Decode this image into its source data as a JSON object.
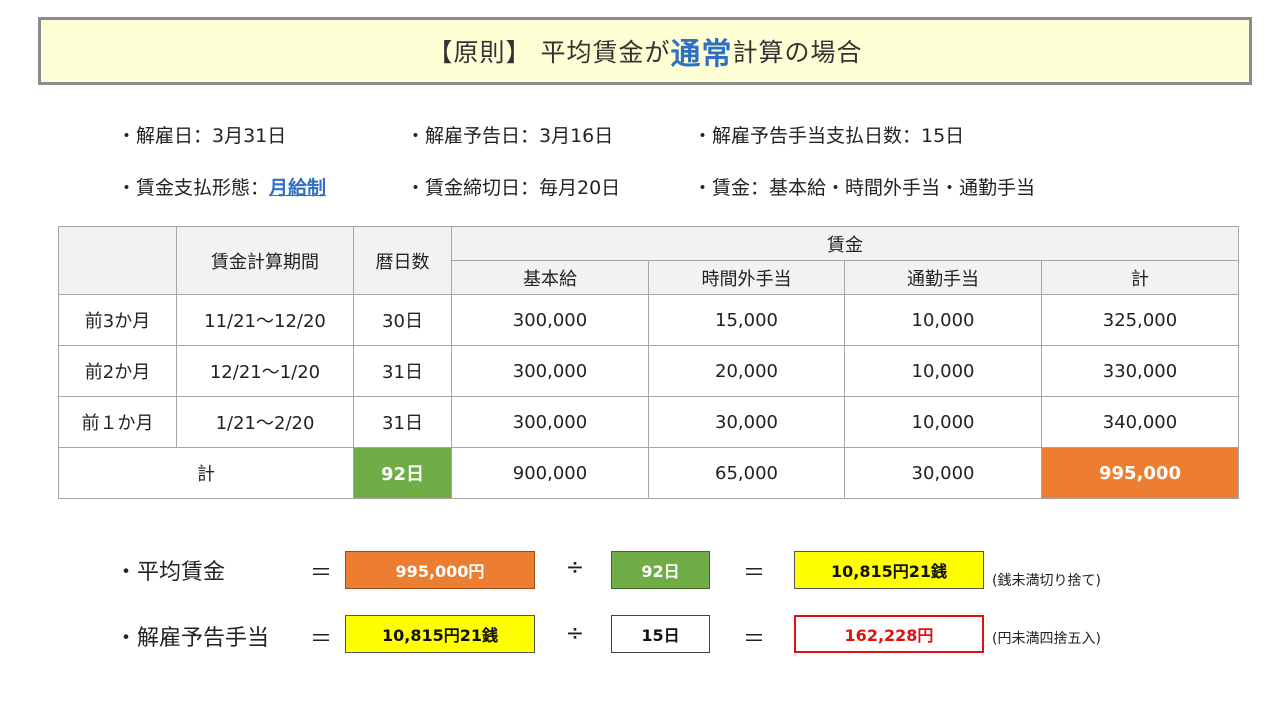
{
  "title": {
    "prefix": "【原則】 平均賃金が",
    "accent": "通常",
    "suffix": "計算の場合"
  },
  "info": {
    "dismissal_date": "・解雇日：3月31日",
    "notice_date": "・解雇予告日：3月16日",
    "allowance_days": "・解雇予告手当支払日数：15日",
    "pay_form_label": "・賃金支払形態：",
    "pay_form_value": "月給制",
    "cutoff": "・賃金締切日：毎月20日",
    "wage_items": "・賃金：基本給・時間外手当・通勤手当"
  },
  "table": {
    "headers": {
      "period": "賃金計算期間",
      "days": "暦日数",
      "wages": "賃金",
      "basic": "基本給",
      "overtime": "時間外手当",
      "commute": "通勤手当",
      "total": "計"
    },
    "rows": [
      {
        "label": "前3か月",
        "period": "11/21～12/20",
        "days": "30日",
        "basic": "300,000",
        "overtime": "15,000",
        "commute": "10,000",
        "total": "325,000"
      },
      {
        "label": "前2か月",
        "period": "12/21～1/20",
        "days": "31日",
        "basic": "300,000",
        "overtime": "20,000",
        "commute": "10,000",
        "total": "330,000"
      },
      {
        "label": "前１か月",
        "period": "1/21～2/20",
        "days": "31日",
        "basic": "300,000",
        "overtime": "30,000",
        "commute": "10,000",
        "total": "340,000"
      }
    ],
    "sum": {
      "label": "計",
      "days": "92日",
      "basic": "900,000",
      "overtime": "65,000",
      "commute": "30,000",
      "total": "995,000"
    }
  },
  "calc": {
    "average": {
      "label": "・平均賃金",
      "eq": "＝",
      "operand1": "995,000円",
      "div": "÷",
      "operand2": "92日",
      "eq2": "＝",
      "result": "10,815円21銭",
      "note": "(銭未満切り捨て)"
    },
    "allowance": {
      "label": "・解雇予告手当",
      "eq": "＝",
      "operand1": "10,815円21銭",
      "div": "÷",
      "operand2": "15日",
      "eq2": "＝",
      "result": "162,228円",
      "note": "(円未満四捨五入)"
    }
  },
  "colors": {
    "accent": "#2f6fc4",
    "title_bg": "#ffffd6",
    "green": "#70ad47",
    "orange": "#ed7d31",
    "yellow": "#ffff00",
    "red": "#e01010"
  }
}
